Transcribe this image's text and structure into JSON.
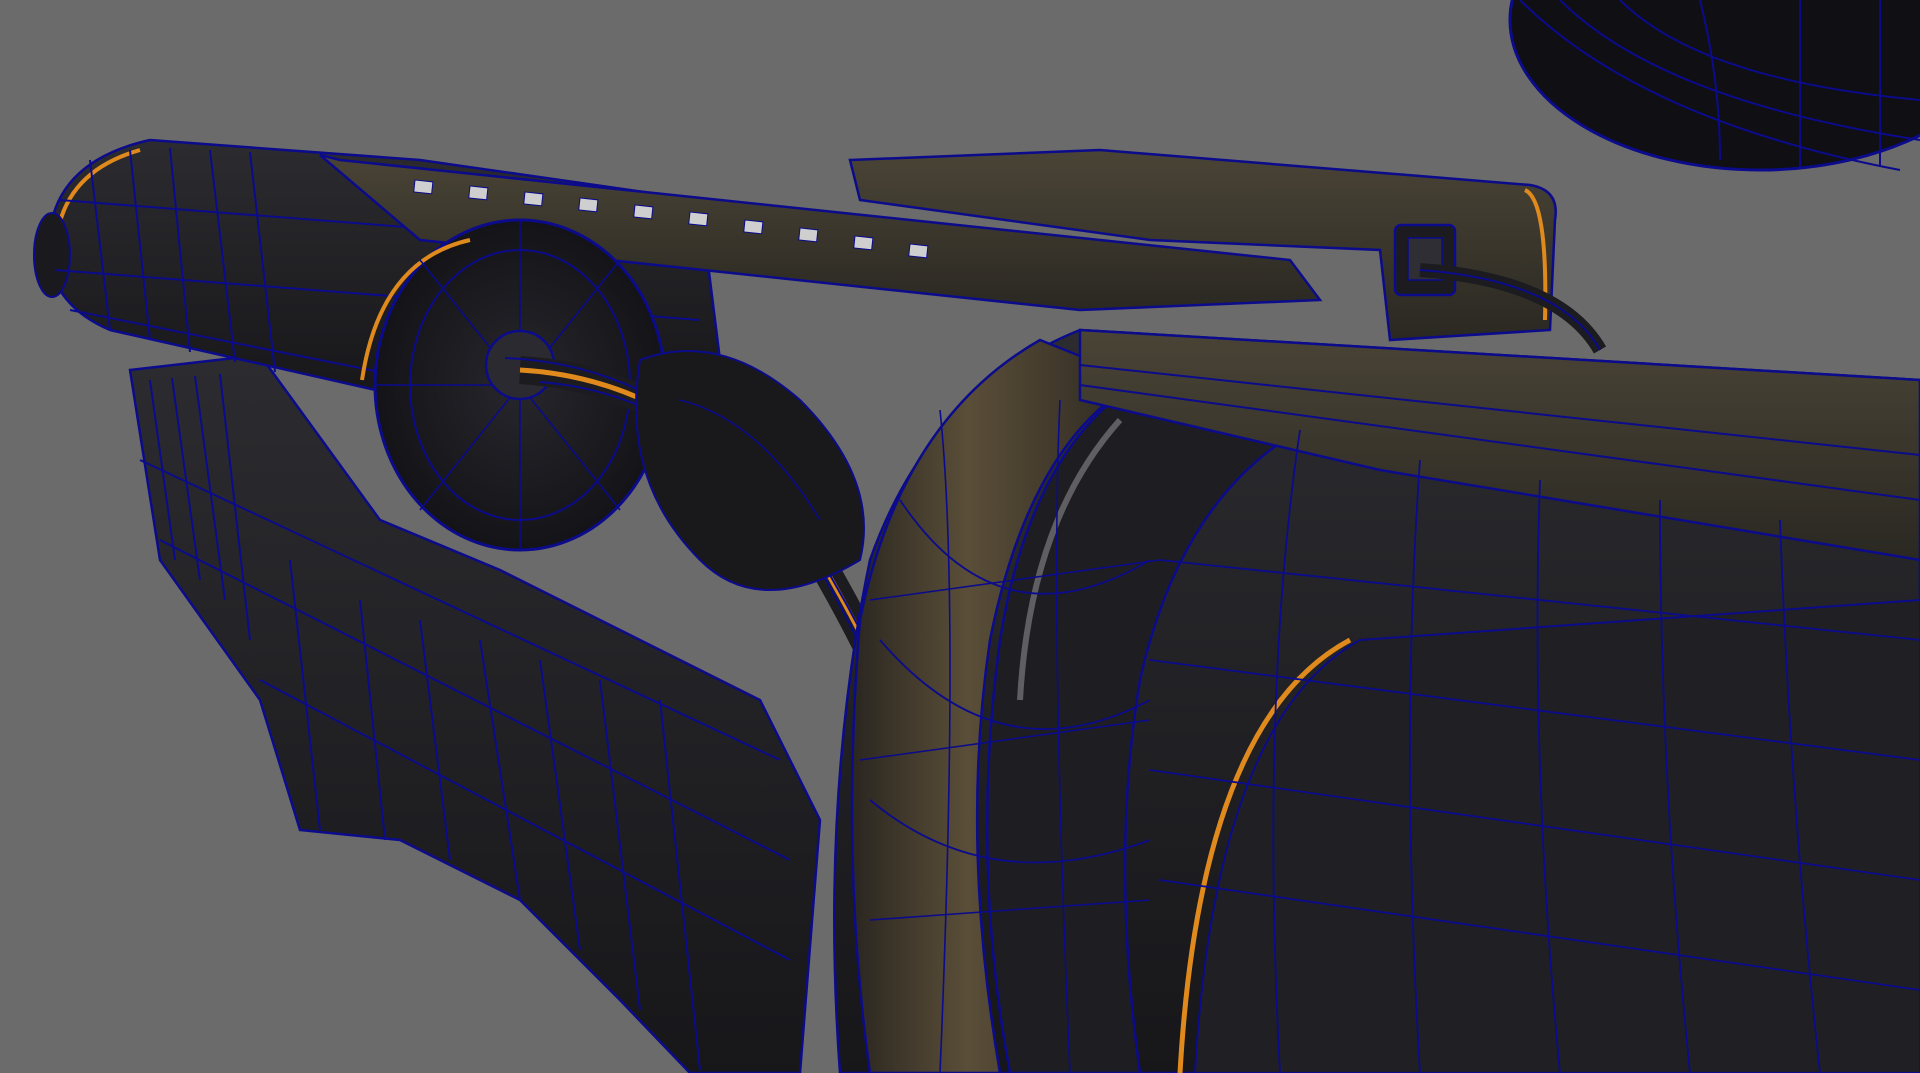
{
  "viewport": {
    "background_color": "#6b6b6b",
    "mesh_fill_color": "#1c1c20",
    "mesh_mid_color": "#2a2a2e",
    "wireframe_color": "#0b0b8c",
    "accent_color": "#e08a1e",
    "bronze_color": "#4e4432",
    "highlight_color": "#8a8a90"
  }
}
